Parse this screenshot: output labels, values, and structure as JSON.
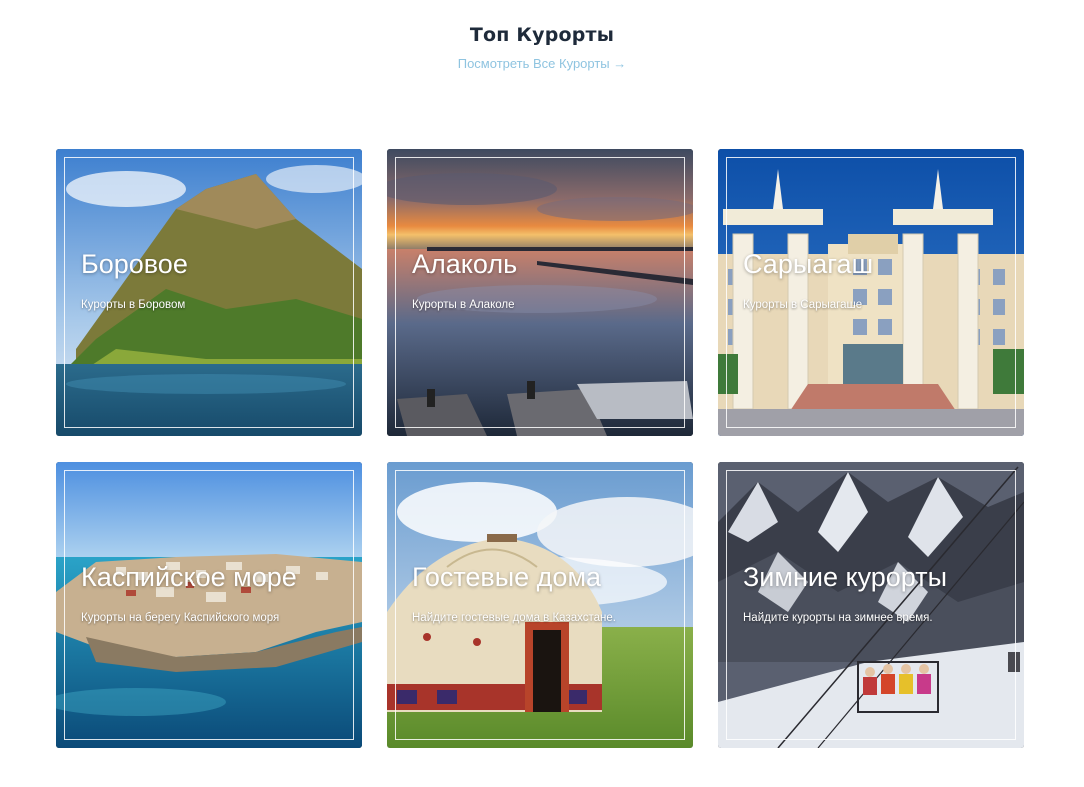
{
  "header": {
    "title": "Топ Курорты",
    "view_all": "Посмотреть Все Курорты →"
  },
  "cards": [
    {
      "title": "Боровое",
      "subtitle": "Курорты в Боровом"
    },
    {
      "title": "Алаколь",
      "subtitle": "Курорты в Алаколе"
    },
    {
      "title": "Сарыагаш",
      "subtitle": "Курорты в Сарыагаше"
    },
    {
      "title": "Каспийское море",
      "subtitle": "Курорты на берегу Каспийского моря"
    },
    {
      "title": "Гостевые дома",
      "subtitle": "Найдите гостевые дома в Казахстане."
    },
    {
      "title": "Зимние курорты",
      "subtitle": "Найдите курорты на зимнее время."
    }
  ],
  "colors": {
    "title": "#1e2a3a",
    "link": "#8fc4e0",
    "overlay_text": "#ffffff"
  }
}
